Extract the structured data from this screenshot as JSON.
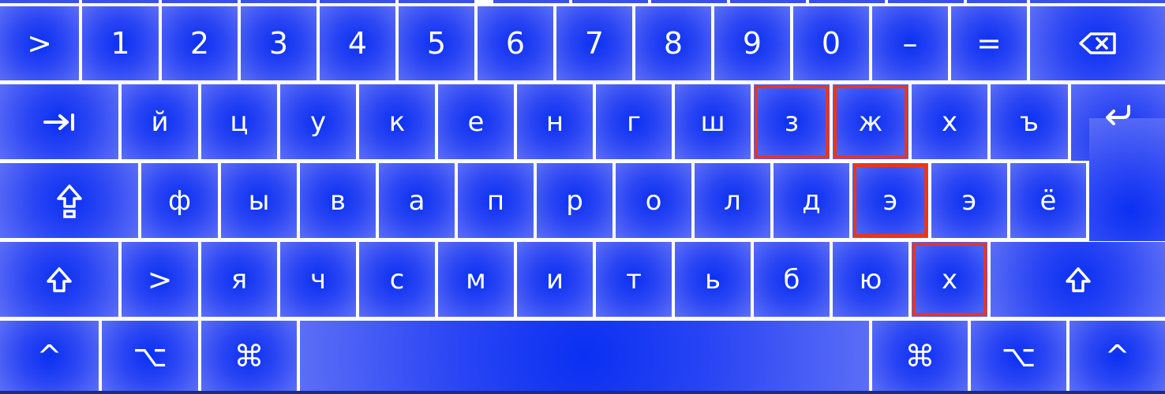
{
  "keyboard": {
    "layout": "Russian",
    "key_color": "#2a45f4",
    "highlight_color": "#e8361d",
    "row1": [
      ">",
      "1",
      "2",
      "3",
      "4",
      "5",
      "6",
      "7",
      "8",
      "9",
      "0",
      "–",
      "="
    ],
    "row1_icons": {
      "backspace": "backspace-icon"
    },
    "row2": [
      "й",
      "ц",
      "у",
      "к",
      "е",
      "н",
      "г",
      "ш",
      "з",
      "ж",
      "х",
      "ъ"
    ],
    "row2_icons": {
      "tab": "tab-icon",
      "enter": "return-icon"
    },
    "row3": [
      "ф",
      "ы",
      "в",
      "а",
      "п",
      "р",
      "о",
      "л",
      "д",
      "э",
      "э",
      "ё"
    ],
    "row3_icons": {
      "caps_lock": "caps-lock-icon"
    },
    "row4": [
      ">",
      "я",
      "ч",
      "с",
      "м",
      "и",
      "т",
      "ь",
      "б",
      "ю",
      "х"
    ],
    "row4_icons": {
      "shift_left": "shift-icon",
      "shift_right": "shift-icon"
    },
    "row5": {
      "ctrl_left": "^",
      "alt_left": "⌥",
      "cmd_left": "⌘",
      "cmd_right": "⌘",
      "alt_right": "⌥",
      "ctrl_right": "^"
    },
    "highlighted_keys": [
      "з",
      "ж",
      "э",
      "х"
    ]
  }
}
